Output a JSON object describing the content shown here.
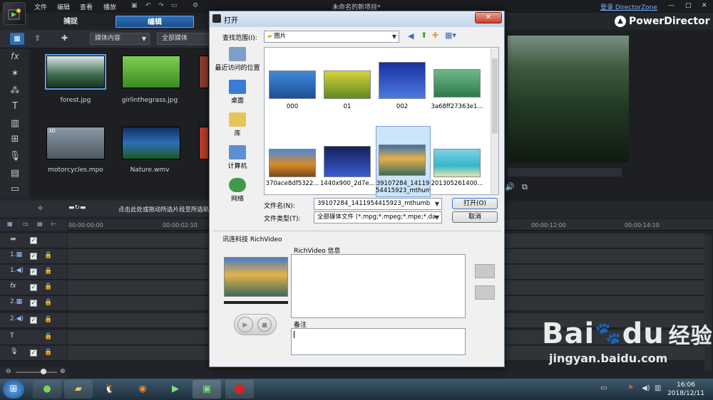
{
  "menubar": {
    "items": [
      "文件",
      "编辑",
      "查看",
      "播放"
    ],
    "title": "未命名的新项目*",
    "directorzone_link": "登录 DirectorZone"
  },
  "brand": "PowerDirector",
  "mode_tabs": {
    "capture": "捕捉",
    "edit": "编辑"
  },
  "toolbar": {
    "media_filter": "媒体内容",
    "all_media": "全部媒体"
  },
  "media_items": [
    {
      "label": "forest.jpg",
      "color": "#3e6a4c"
    },
    {
      "label": "girlinthegrass.jpg",
      "color": "#4ea63a"
    },
    {
      "label": "motorcycles.mpo",
      "color": "#6c7a86"
    },
    {
      "label": "Nature.wmv",
      "color": "#2d6fb8"
    }
  ],
  "media_badge_3d": "3D",
  "bottom_hint": "点击此处或拖动所选片段至所选轨",
  "timeline": {
    "timecodes": [
      "00:00:00:00",
      "00:00:02:10",
      "00:00:12:00",
      "00:00:14:10"
    ],
    "tracks": [
      {
        "label": "1.",
        "kind": "video"
      },
      {
        "label": "1.",
        "kind": "audio"
      },
      {
        "label": "fx",
        "kind": "fx"
      },
      {
        "label": "2.",
        "kind": "video"
      },
      {
        "label": "2.",
        "kind": "audio"
      },
      {
        "label": "T",
        "kind": "title"
      },
      {
        "label": "",
        "kind": "voice"
      },
      {
        "label": "",
        "kind": "music"
      }
    ]
  },
  "dialog": {
    "title": "打开",
    "look_in_label": "查找范围(I):",
    "look_in_value": "图片",
    "places": [
      {
        "label": "最近访问的位置",
        "color": "#7ea0c6"
      },
      {
        "label": "桌面",
        "color": "#3a7bd5"
      },
      {
        "label": "库",
        "color": "#e7c45a"
      },
      {
        "label": "计算机",
        "color": "#5b8fd1"
      },
      {
        "label": "网络",
        "color": "#3f9b4b"
      }
    ],
    "files": [
      {
        "name": "000",
        "color": "#2c74c9"
      },
      {
        "name": "01",
        "color": "#b8b12b"
      },
      {
        "name": "002",
        "color": "#2f59c9"
      },
      {
        "name": "3a68ff27363e1...",
        "color": "#4f9a6a"
      },
      {
        "name": "370ace8df5322...",
        "color": "#d98b2b"
      },
      {
        "name": "1440x900_2d7e...",
        "color": "#2b3f8c"
      },
      {
        "name": "39107284_14119 54415923_mthum",
        "color": "#d9a046"
      },
      {
        "name": "201305261400...",
        "color": "#35b8c9"
      }
    ],
    "filename_label": "文件名(N):",
    "filename_value": "39107284_1411954415923_mthumb",
    "filetype_label": "文件类型(T):",
    "filetype_value": "全部媒体文件 (*.mpg;*.mpeg;*.mpe;*.da",
    "open_button": "打开(O)",
    "cancel_button": "取消",
    "richvideo_section": "讯连科技 RichVideo",
    "richvideo_info_label": "RichVideo 信息",
    "notes_label": "备注"
  },
  "clock": {
    "time": "16:06",
    "date": "2018/12/11"
  },
  "watermark": {
    "brand": "Bai",
    "brand2": "du",
    "cn": "经验",
    "url": "jingyan.baidu.com"
  }
}
